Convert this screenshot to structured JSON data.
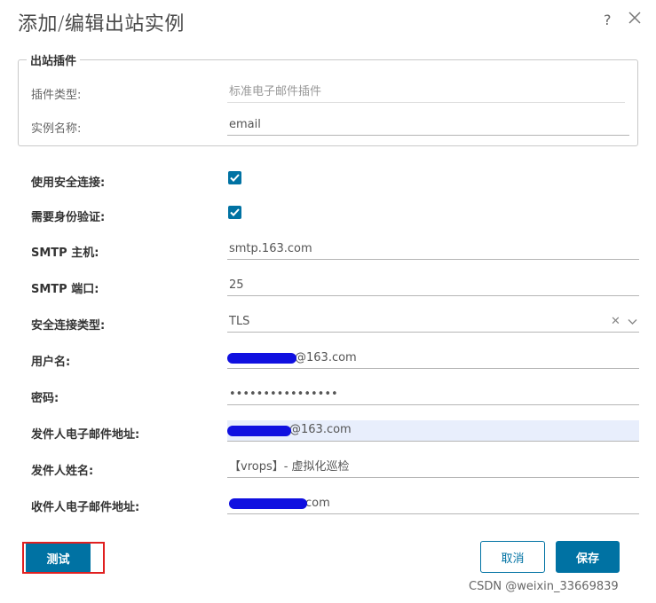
{
  "dialog": {
    "title": "添加/编辑出站实例",
    "help_label": "?",
    "watermark": "CSDN @weixin_33669839"
  },
  "plugin_section": {
    "legend": "出站插件",
    "plugin_type_label": "插件类型:",
    "plugin_type_value": "标准电子邮件插件",
    "instance_name_label": "实例名称:",
    "instance_name_value": "email"
  },
  "form": {
    "secure_connection_label": "使用安全连接:",
    "auth_required_label": "需要身份验证:",
    "smtp_host_label": "SMTP 主机:",
    "smtp_host_value": "smtp.163.com",
    "smtp_port_label": "SMTP 端口:",
    "smtp_port_value": "25",
    "secure_type_label": "安全连接类型:",
    "secure_type_value": "TLS",
    "username_label": "用户名:",
    "username_value": "@163.com",
    "password_label": "密码:",
    "password_value": "••••••••••••••••",
    "sender_email_label": "发件人电子邮件地址:",
    "sender_email_value": "@163.com",
    "sender_name_label": "发件人姓名:",
    "sender_name_value": "【vrops】- 虚拟化巡检",
    "recipient_email_label": "收件人电子邮件地址:",
    "recipient_email_value": "com"
  },
  "buttons": {
    "test_label": "测试",
    "cancel_label": "取消",
    "save_label": "保存"
  },
  "colors": {
    "primary": "#0072a3",
    "highlight": "#e8eefc",
    "redaction": "#1010e0",
    "annotation": "#e02020"
  }
}
